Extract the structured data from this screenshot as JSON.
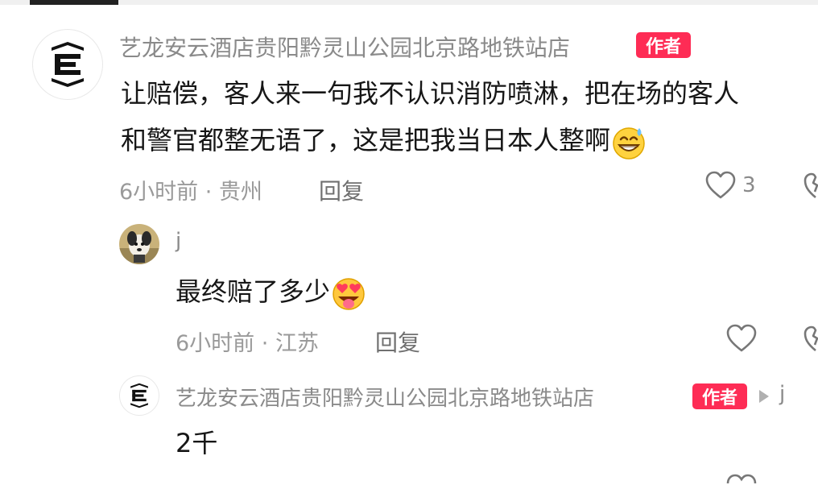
{
  "comment": {
    "author": "艺龙安云酒店贵阳黔灵山公园北京路地铁站店",
    "badge": "作者",
    "text_line1": "让赔偿，客人来一句我不认识消防喷淋，把在场的客人",
    "text_line2": "和警官都整无语了，这是把我当日本人整啊",
    "emoji": "grinning-sweat-emoji",
    "time": "6小时前",
    "location": "贵州",
    "reply_label": "回复",
    "like_count": "3"
  },
  "reply1": {
    "author": "j",
    "text": "最终赔了多少",
    "emoji": "heart-eyes-tongue-emoji",
    "time": "6小时前",
    "location": "江苏",
    "reply_label": "回复"
  },
  "reply2": {
    "author": "艺龙安云酒店贵阳黔灵山公园北京路地铁站店",
    "badge": "作者",
    "reply_to": "j",
    "text": "2千"
  },
  "icons": {
    "like": "heart-outline-icon",
    "dislike": "broken-heart-outline-icon",
    "arrow": "play-arrow-icon"
  },
  "colors": {
    "badge": "#fe2c55",
    "secondary_text": "#8a8a8a"
  }
}
